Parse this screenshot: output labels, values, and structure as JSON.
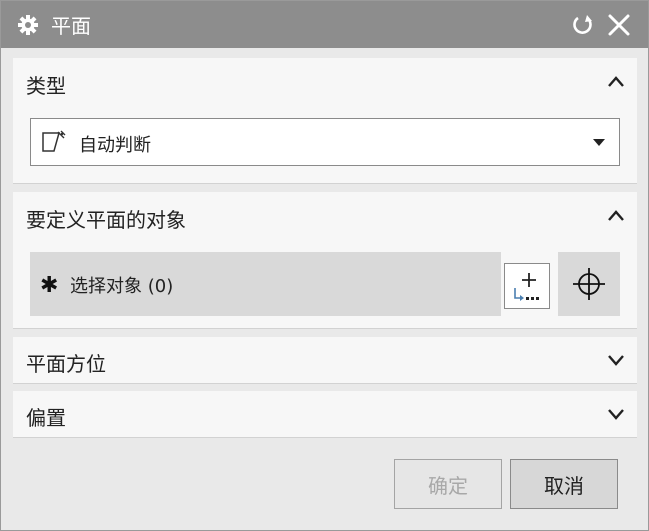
{
  "window": {
    "title": "平面",
    "icons": {
      "app": "gear-icon",
      "reset": "reset-icon",
      "close": "close-icon"
    }
  },
  "sections": {
    "type": {
      "label": "类型",
      "expanded": true,
      "dropdown": {
        "icon": "plane-inferred-icon",
        "value": "自动判断"
      }
    },
    "objects": {
      "label": "要定义平面的对象",
      "expanded": true,
      "select_label": "选择对象 (0)",
      "required_marker": "✱",
      "icons": {
        "add": "add-new-set-icon",
        "point_dialog": "crosshair-icon"
      }
    },
    "orientation": {
      "label": "平面方位",
      "expanded": false
    },
    "offset": {
      "label": "偏置",
      "expanded": false
    }
  },
  "footer": {
    "ok_label": "确定",
    "ok_enabled": false,
    "cancel_label": "取消"
  },
  "colors": {
    "titlebar": "#8d8d8d",
    "panel": "#f7f7f7",
    "background": "#e9e9e9",
    "selection_bar": "#d9d9d9"
  }
}
